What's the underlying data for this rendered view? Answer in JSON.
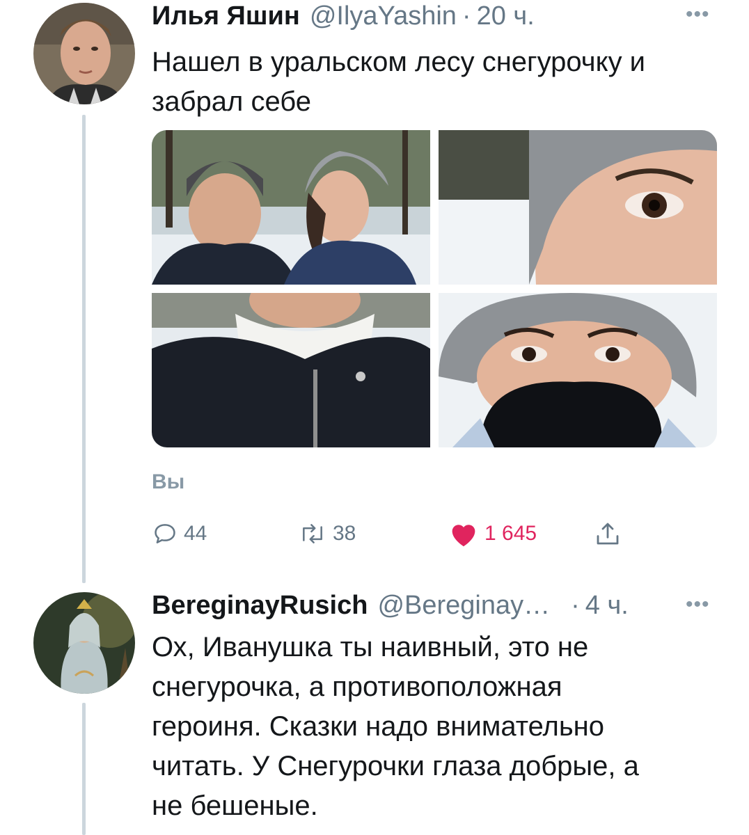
{
  "tweet": {
    "author_name": "Илья Яшин",
    "author_handle": "@IlyaYashin",
    "separator": "·",
    "time": "20 ч.",
    "more": "•••",
    "text_lines": [
      "Нашел в уральском лесу снегурочку и",
      "забрал себе"
    ],
    "by_you": "Вы",
    "actions": {
      "reply_icon": "reply-icon",
      "reply_count": "44",
      "retweet_icon": "retweet-icon",
      "retweet_count": "38",
      "like_icon": "heart-filled-icon",
      "like_count": "1 645",
      "share_icon": "share-icon"
    },
    "like_color": "#e0245e"
  },
  "reply": {
    "author_name": "BereginayRusich",
    "author_handle": "@Bereginay…",
    "separator": "·",
    "time": "4 ч.",
    "more": "•••",
    "text_lines": [
      "Ох, Иванушка ты наивный, это не",
      "снегурочка, а противоположная",
      "героиня. Сказки надо внимательно",
      "читать. У Снегурочки глаза добрые, а",
      "не бешеные."
    ]
  }
}
